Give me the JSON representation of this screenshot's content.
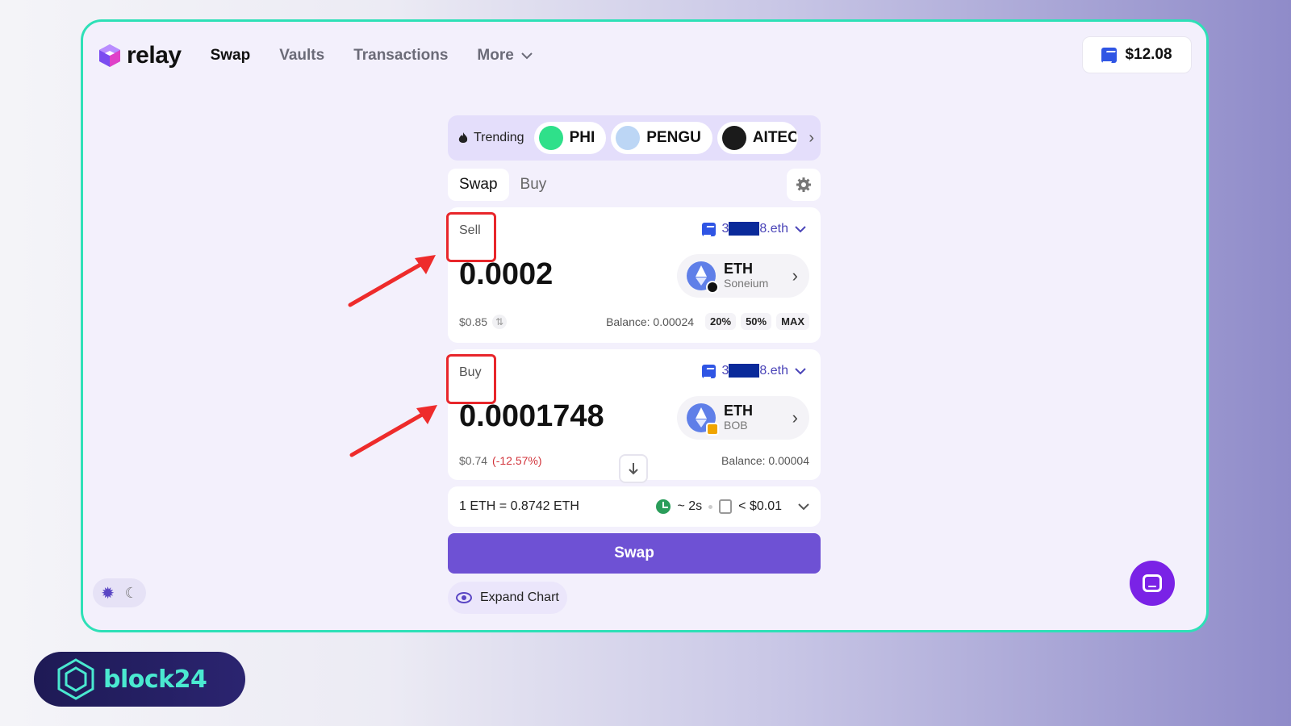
{
  "nav": {
    "brand": "relay",
    "links": [
      "Swap",
      "Vaults",
      "Transactions",
      "More"
    ],
    "balance": "$12.08"
  },
  "trending": {
    "label": "Trending",
    "tokens": [
      "PHI",
      "PENGU",
      "AITEC"
    ]
  },
  "tabs": [
    "Swap",
    "Buy"
  ],
  "sell": {
    "label": "Sell",
    "address_prefix": "3",
    "address_suffix": "8.eth",
    "amount": "0.0002",
    "token": "ETH",
    "chain": "Soneium",
    "usd": "$0.85",
    "balance": "Balance: 0.00024",
    "presets": [
      "20%",
      "50%",
      "MAX"
    ]
  },
  "buy": {
    "label": "Buy",
    "address_prefix": "3",
    "address_suffix": "8.eth",
    "amount": "0.0001748",
    "token": "ETH",
    "chain": "BOB",
    "usd": "$0.74",
    "change": "(-12.57%)",
    "balance": "Balance: 0.00004"
  },
  "rate": {
    "text": "1 ETH = 0.8742 ETH",
    "time": "~ 2s",
    "fee": "< $0.01"
  },
  "swap_button": "Swap",
  "expand_chart": "Expand Chart",
  "watermark": "block24",
  "colors": {
    "accent": "#6e51d4",
    "frame_border": "#2ee0b7",
    "highlight": "#e8262b",
    "negative": "#d2343b"
  }
}
